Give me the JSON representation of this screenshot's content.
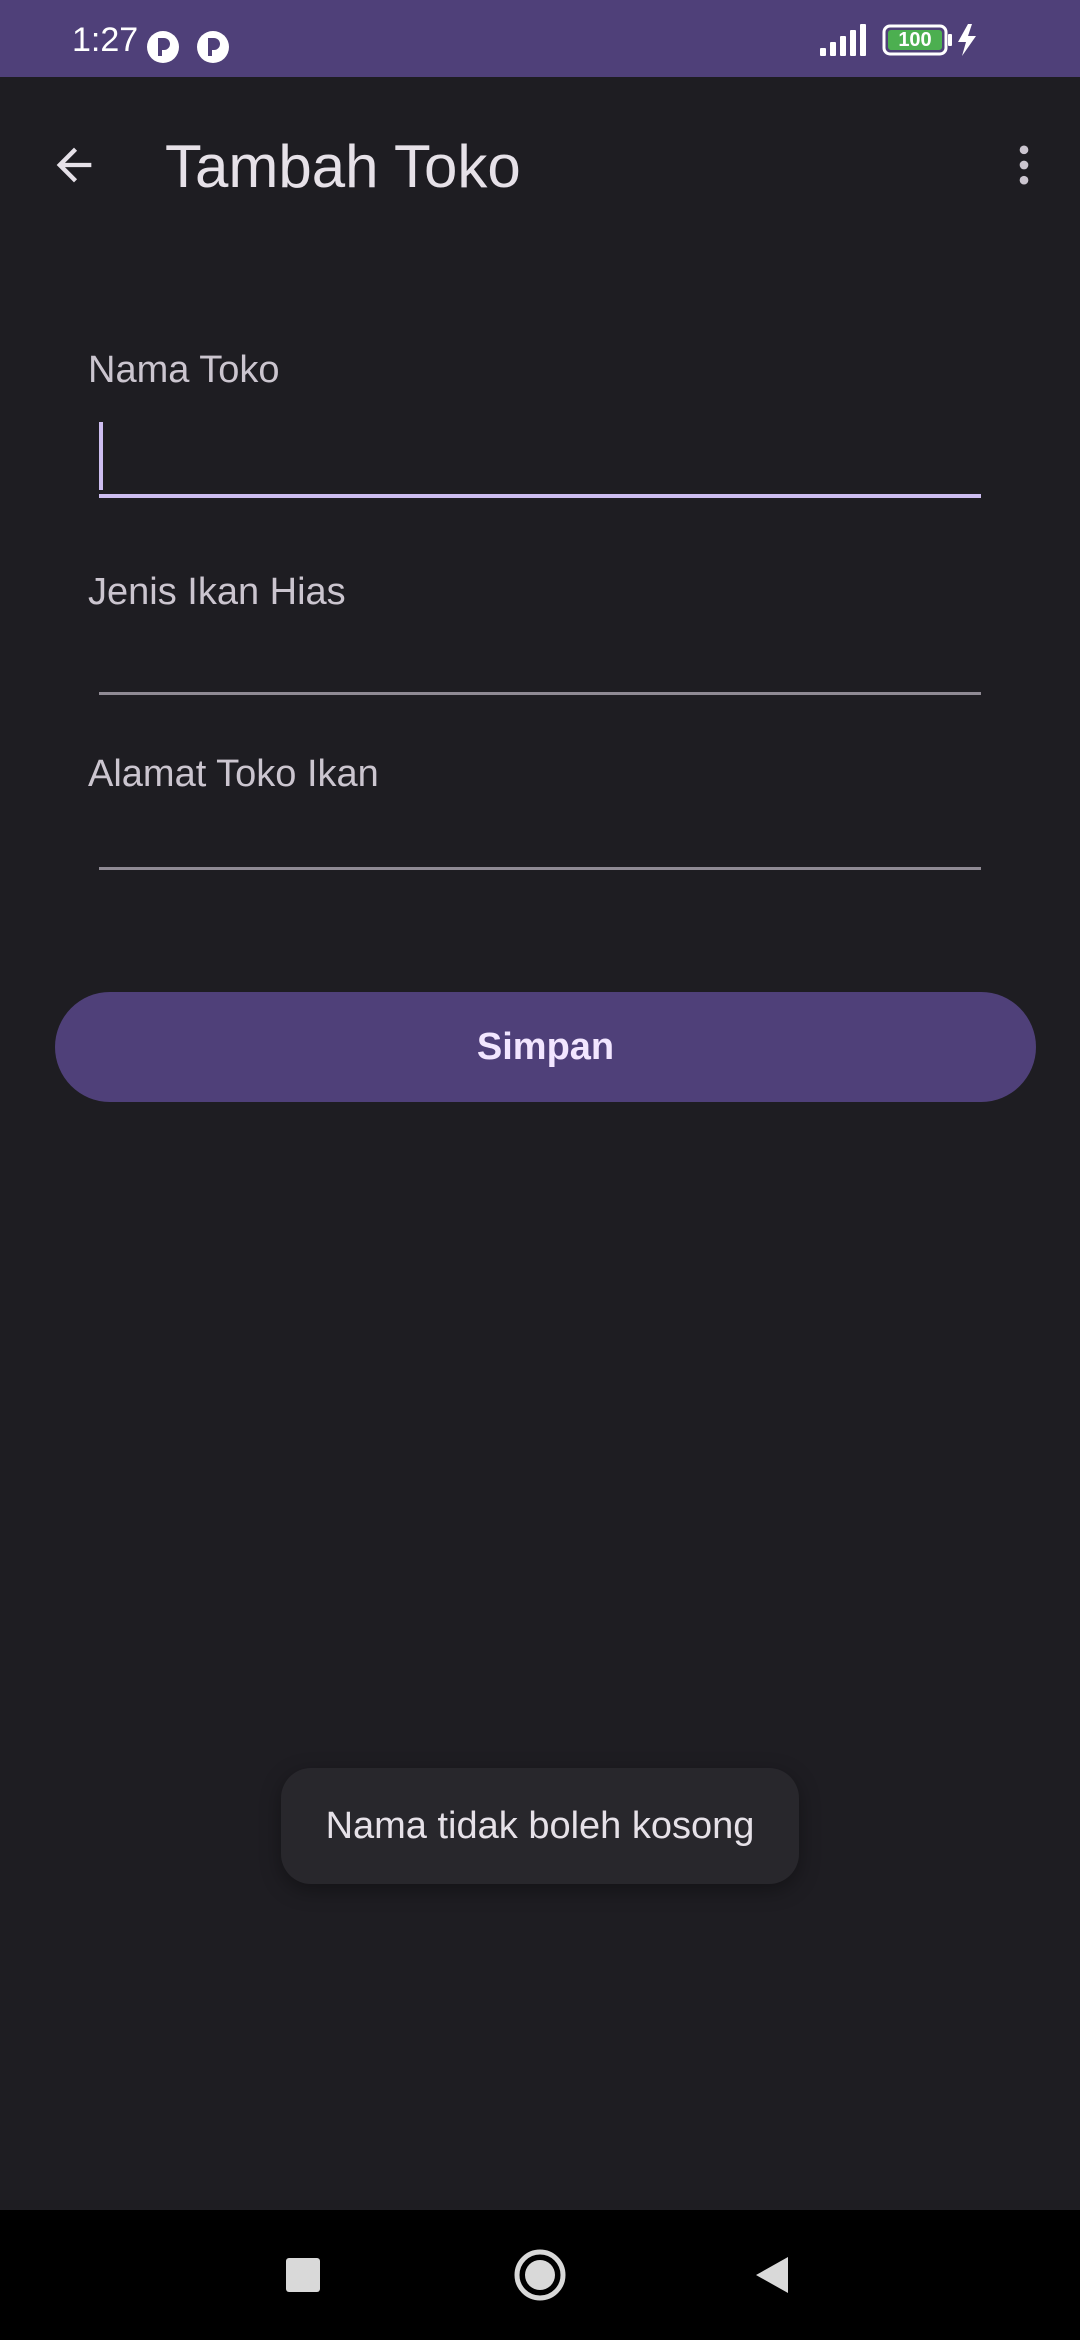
{
  "status_bar": {
    "time": "1:27",
    "battery_level": "100",
    "colors": {
      "background": "#4f4079"
    }
  },
  "app_bar": {
    "title": "Tambah Toko",
    "back_icon": "arrow-back-icon",
    "menu_icon": "more-vert-icon"
  },
  "form": {
    "fields": [
      {
        "label": "Nama Toko",
        "value": "",
        "focused": true
      },
      {
        "label": "Jenis Ikan Hias",
        "value": "",
        "focused": false
      },
      {
        "label": "Alamat Toko Ikan",
        "value": "",
        "focused": false
      }
    ],
    "save_label": "Simpan"
  },
  "toast": {
    "message": "Nama tidak boleh kosong"
  },
  "nav_bar": {
    "icons": [
      "recents-square-icon",
      "home-circle-icon",
      "back-triangle-icon"
    ]
  },
  "colors": {
    "background": "#1e1d22",
    "accent": "#4f4079",
    "focus": "#cdbdf0",
    "text": "#e6e1e8",
    "label": "#cbc5cf"
  }
}
